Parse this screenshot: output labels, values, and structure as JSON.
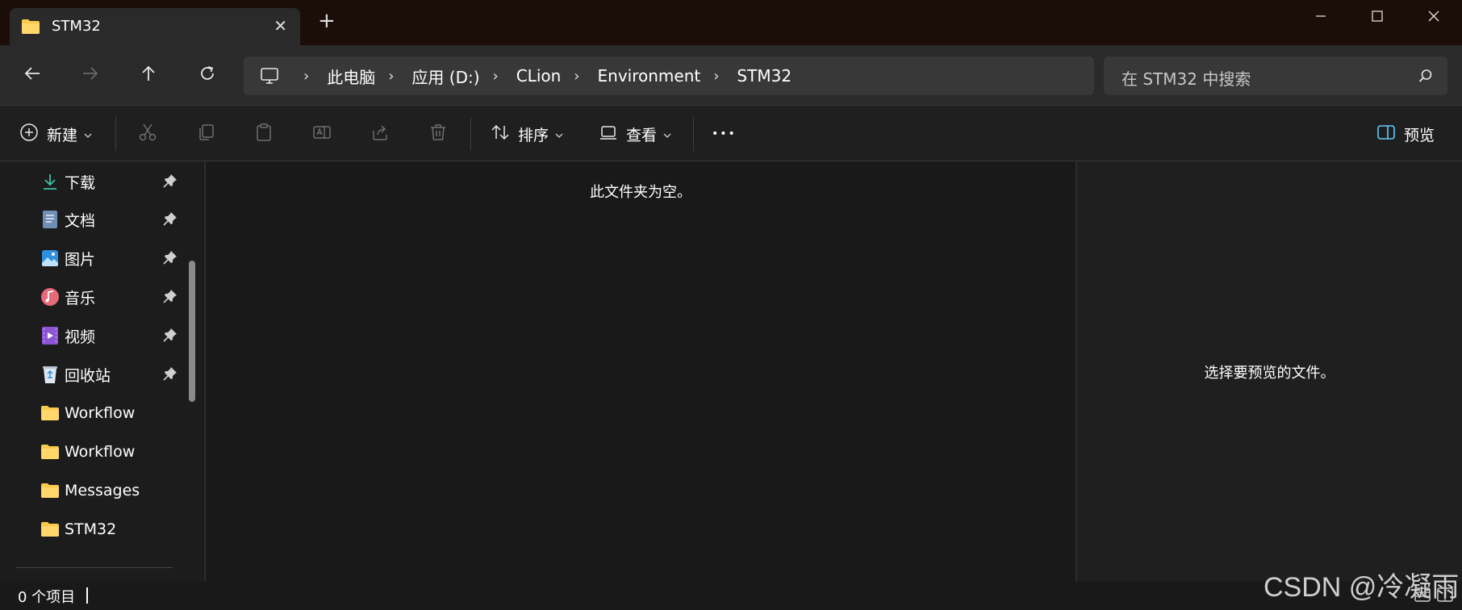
{
  "window": {
    "tab_title": "STM32",
    "tab_close_glyph": "✕",
    "new_tab_glyph": "+"
  },
  "nav": {
    "back_icon": "arrow-left-icon",
    "forward_icon": "arrow-right-icon",
    "up_icon": "arrow-up-icon",
    "refresh_icon": "refresh-icon"
  },
  "breadcrumb": {
    "separator": "›",
    "items": [
      "此电脑",
      "应用 (D:)",
      "CLion",
      "Environment",
      "STM32"
    ]
  },
  "search": {
    "placeholder": "在 STM32 中搜索"
  },
  "toolbar": {
    "new_label": "新建",
    "sort_label": "排序",
    "view_label": "查看",
    "more_glyph": "•••",
    "preview_label": "预览"
  },
  "sidebar": {
    "items": [
      {
        "label": "下载",
        "icon": "download-icon",
        "pinned": true
      },
      {
        "label": "文档",
        "icon": "document-icon",
        "pinned": true
      },
      {
        "label": "图片",
        "icon": "pictures-icon",
        "pinned": true
      },
      {
        "label": "音乐",
        "icon": "music-icon",
        "pinned": true
      },
      {
        "label": "视频",
        "icon": "video-icon",
        "pinned": true
      },
      {
        "label": "回收站",
        "icon": "recycle-bin-icon",
        "pinned": true
      },
      {
        "label": "Workflow",
        "icon": "folder-icon",
        "pinned": false
      },
      {
        "label": "Workflow",
        "icon": "folder-icon",
        "pinned": false
      },
      {
        "label": "Messages",
        "icon": "folder-icon",
        "pinned": false
      },
      {
        "label": "STM32",
        "icon": "folder-icon",
        "pinned": false
      }
    ]
  },
  "main": {
    "empty_message": "此文件夹为空。"
  },
  "preview": {
    "message": "选择要预览的文件。"
  },
  "status": {
    "item_count": "0 个项目"
  },
  "watermark": "CSDN @冷凝雨",
  "colors": {
    "titlebar": "#1b0e09",
    "navbar": "#2a2a2a",
    "field": "#383838",
    "accent": "#60cdff",
    "folder": "#f8c94b"
  }
}
